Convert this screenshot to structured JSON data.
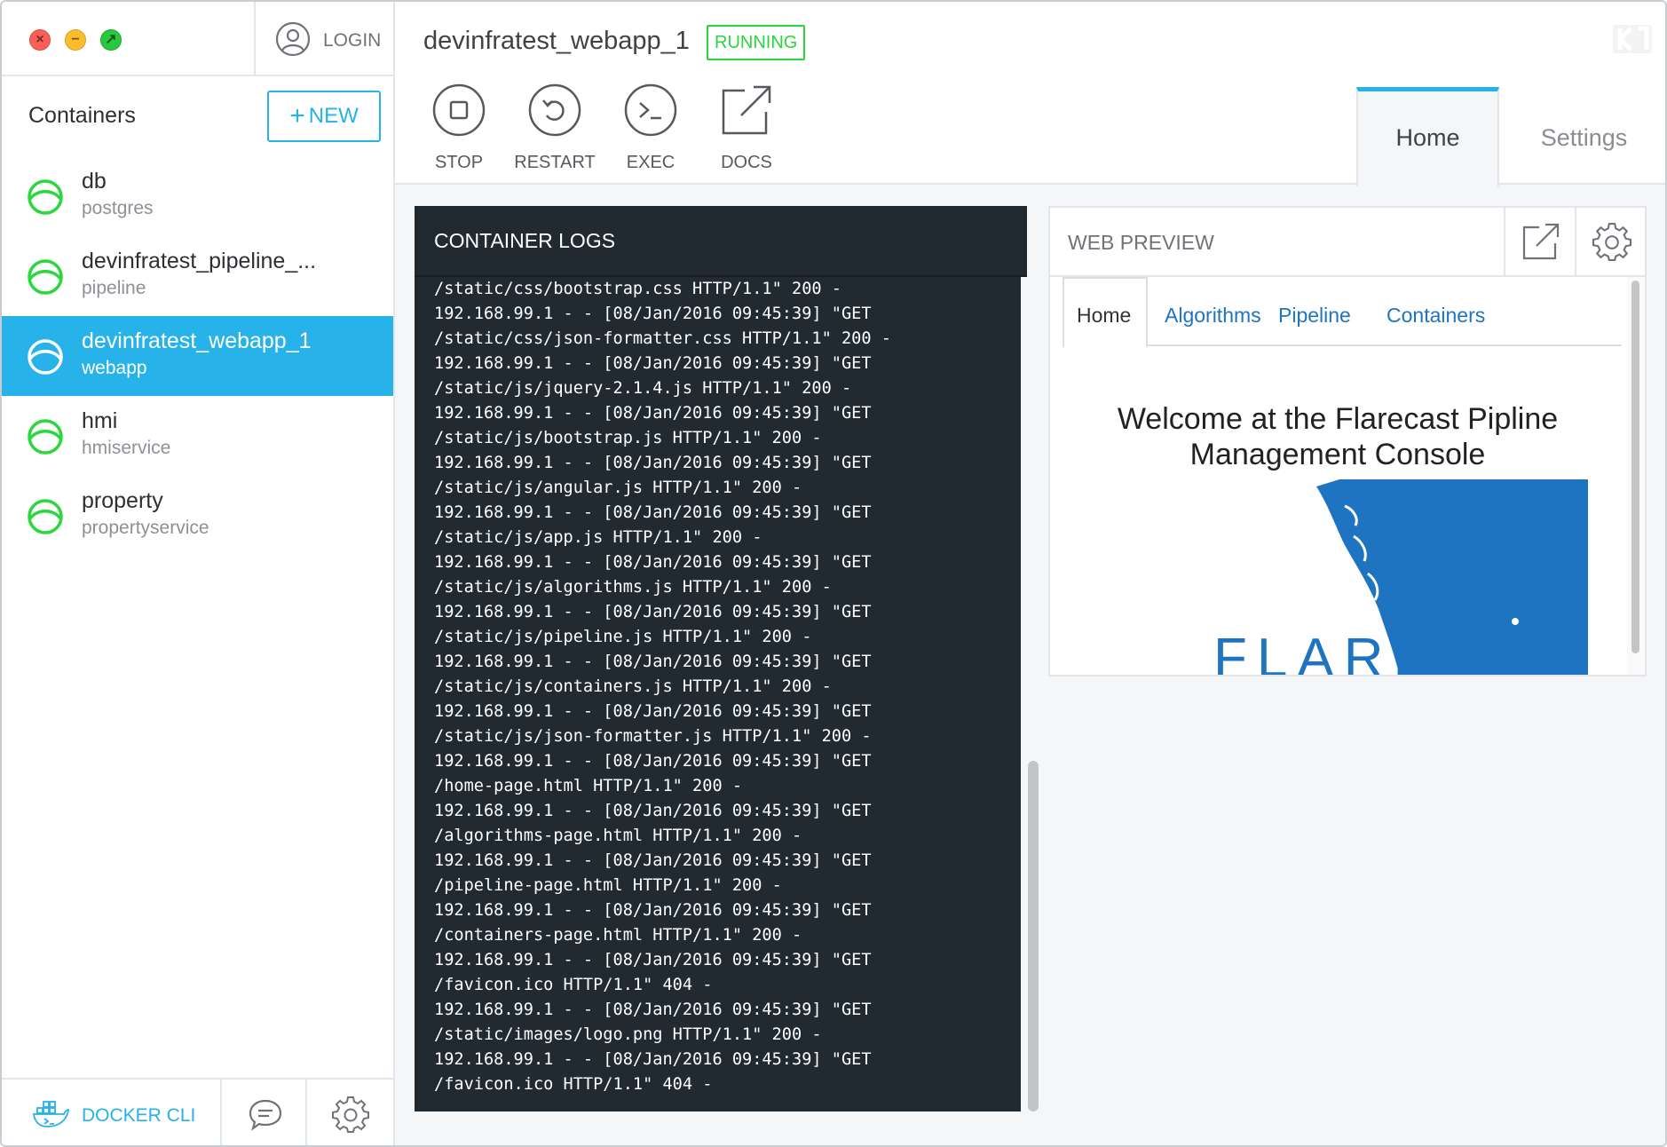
{
  "window": {
    "traffic_lights": {
      "close_glyph": "×",
      "minimize_glyph": "−",
      "zoom_glyph": "↗"
    }
  },
  "sidebar": {
    "login_label": "LOGIN",
    "title": "Containers",
    "new_button": {
      "plus": "+",
      "label": "NEW"
    },
    "containers": [
      {
        "name": "db",
        "image": "postgres",
        "active": false
      },
      {
        "name": "devinfratest_pipeline_...",
        "image": "pipeline",
        "active": false
      },
      {
        "name": "devinfratest_webapp_1",
        "image": "webapp",
        "active": true
      },
      {
        "name": "hmi",
        "image": "hmiservice",
        "active": false
      },
      {
        "name": "property",
        "image": "propertyservice",
        "active": false
      }
    ],
    "footer": {
      "cli_label": "DOCKER CLI"
    }
  },
  "header": {
    "container_name": "devinfratest_webapp_1",
    "status": "RUNNING",
    "actions": [
      {
        "label": "STOP",
        "icon": "stop-icon"
      },
      {
        "label": "RESTART",
        "icon": "restart-icon"
      },
      {
        "label": "EXEC",
        "icon": "terminal-icon"
      },
      {
        "label": "DOCS",
        "icon": "external-link-icon"
      }
    ],
    "tabs": [
      {
        "label": "Home",
        "active": true
      },
      {
        "label": "Settings",
        "active": false
      }
    ]
  },
  "logs": {
    "title": "CONTAINER LOGS",
    "lines": [
      "/static/css/bootstrap.css HTTP/1.1\" 200 -",
      "192.168.99.1 - - [08/Jan/2016 09:45:39] \"GET",
      "/static/css/json-formatter.css HTTP/1.1\" 200 -",
      "192.168.99.1 - - [08/Jan/2016 09:45:39] \"GET",
      "/static/js/jquery-2.1.4.js HTTP/1.1\" 200 -",
      "192.168.99.1 - - [08/Jan/2016 09:45:39] \"GET",
      "/static/js/bootstrap.js HTTP/1.1\" 200 -",
      "192.168.99.1 - - [08/Jan/2016 09:45:39] \"GET",
      "/static/js/angular.js HTTP/1.1\" 200 -",
      "192.168.99.1 - - [08/Jan/2016 09:45:39] \"GET",
      "/static/js/app.js HTTP/1.1\" 200 -",
      "192.168.99.1 - - [08/Jan/2016 09:45:39] \"GET",
      "/static/js/algorithms.js HTTP/1.1\" 200 -",
      "192.168.99.1 - - [08/Jan/2016 09:45:39] \"GET",
      "/static/js/pipeline.js HTTP/1.1\" 200 -",
      "192.168.99.1 - - [08/Jan/2016 09:45:39] \"GET",
      "/static/js/containers.js HTTP/1.1\" 200 -",
      "192.168.99.1 - - [08/Jan/2016 09:45:39] \"GET",
      "/static/js/json-formatter.js HTTP/1.1\" 200 -",
      "192.168.99.1 - - [08/Jan/2016 09:45:39] \"GET",
      "/home-page.html HTTP/1.1\" 200 -",
      "192.168.99.1 - - [08/Jan/2016 09:45:39] \"GET",
      "/algorithms-page.html HTTP/1.1\" 200 -",
      "192.168.99.1 - - [08/Jan/2016 09:45:39] \"GET",
      "/pipeline-page.html HTTP/1.1\" 200 -",
      "192.168.99.1 - - [08/Jan/2016 09:45:39] \"GET",
      "/containers-page.html HTTP/1.1\" 200 -",
      "192.168.99.1 - - [08/Jan/2016 09:45:39] \"GET",
      "/favicon.ico HTTP/1.1\" 404 -",
      "192.168.99.1 - - [08/Jan/2016 09:45:39] \"GET",
      "/static/images/logo.png HTTP/1.1\" 200 -",
      "192.168.99.1 - - [08/Jan/2016 09:45:39] \"GET",
      "/favicon.ico HTTP/1.1\" 404 -"
    ]
  },
  "preview": {
    "title": "WEB PREVIEW",
    "nav": [
      "Home",
      "Algorithms",
      "Pipeline",
      "Containers"
    ],
    "heading_line1": "Welcome at the Flarecast Pipline",
    "heading_line2": "Management Console",
    "logo_text": "FLARECAST"
  },
  "colors": {
    "accent": "#27b3e9",
    "status_running": "#2ad73c",
    "logs_bg": "#212a31",
    "link": "#1f74c2",
    "logo_blue": "#1f74c2"
  }
}
